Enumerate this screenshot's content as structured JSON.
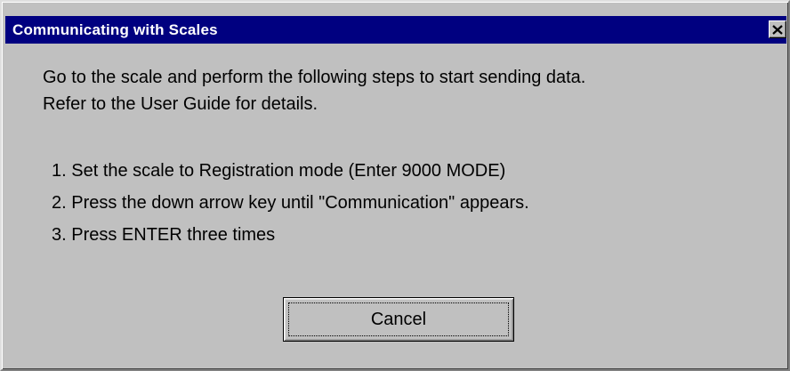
{
  "dialog": {
    "title": "Communicating with Scales",
    "close_icon": "close-icon",
    "message_lines": [
      "Go to the scale and perform the following steps to start sending data.",
      "Refer to the User Guide for details."
    ],
    "steps": [
      "1. Set the scale to Registration mode (Enter 9000 MODE)",
      "2. Press the down arrow key until \"Communication\" appears.",
      "3. Press ENTER three times"
    ],
    "cancel_label": "Cancel"
  },
  "colors": {
    "titlebar": "#000080",
    "face": "#c0c0c0",
    "title_text": "#ffffff"
  }
}
